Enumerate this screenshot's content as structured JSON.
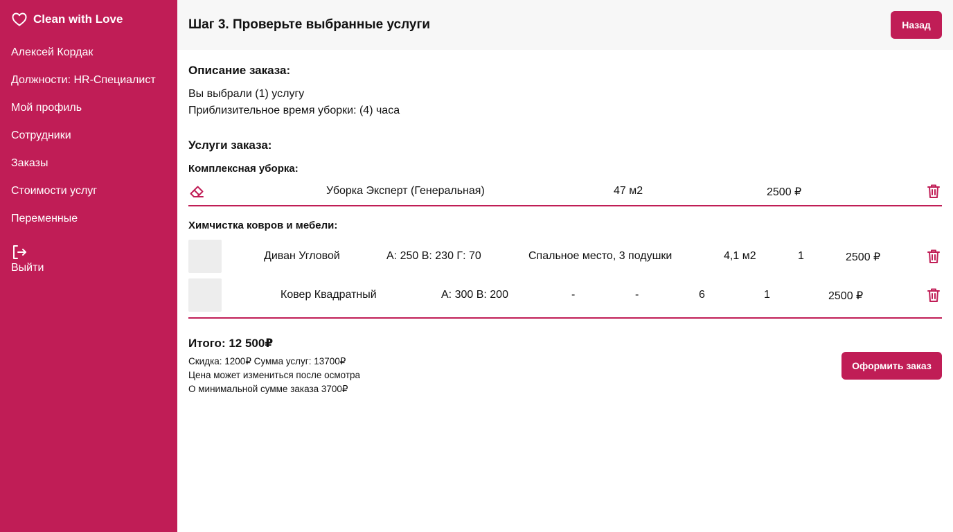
{
  "brand": {
    "name": "Clean with Love",
    "accent": "#c01d56"
  },
  "sidebar": {
    "items": [
      {
        "label": "Алексей Кордак"
      },
      {
        "label": "Должности: HR-Специалист"
      },
      {
        "label": "Мой профиль"
      },
      {
        "label": "Сотрудники"
      },
      {
        "label": "Заказы"
      },
      {
        "label": "Стоимости услуг"
      },
      {
        "label": "Переменные"
      }
    ],
    "logout_label": "Выйти"
  },
  "header": {
    "title": "Шаг 3. Проверьте выбранные услуги",
    "back_label": "Назад"
  },
  "description": {
    "heading": "Описание заказа:",
    "line1": "Вы выбрали (1) услугу",
    "line2": "Приблизительное время уборки: (4) часа"
  },
  "services": {
    "heading": "Услуги заказа:",
    "complex": {
      "category": "Комплексная уборка:",
      "name": "Уборка Эксперт (Генеральная)",
      "area": "47 м2",
      "price": "2500 ₽"
    },
    "dry_cleaning": {
      "category": "Химчистка ковров и мебели:",
      "rows": [
        {
          "name": "Диван Угловой",
          "dims": "А: 250 В: 230 Г: 70",
          "details": "Спальное место, 3 подушки",
          "area": "4,1 м2",
          "qty": "1",
          "price": "2500 ₽"
        },
        {
          "name": "Ковер Квадратный",
          "dims": "А: 300 В: 200",
          "details": "-",
          "extra": "-",
          "area": "6",
          "qty": "1",
          "price": "2500 ₽"
        }
      ]
    }
  },
  "summary": {
    "total": "Итого: 12 500₽",
    "discount_line": "Скидка: 1200₽ Сумма услуг: 13700₽",
    "note1": "Цена может измениться после осмотра",
    "note2": "О минимальной сумме заказа 3700₽",
    "submit_label": "Оформить заказ"
  }
}
